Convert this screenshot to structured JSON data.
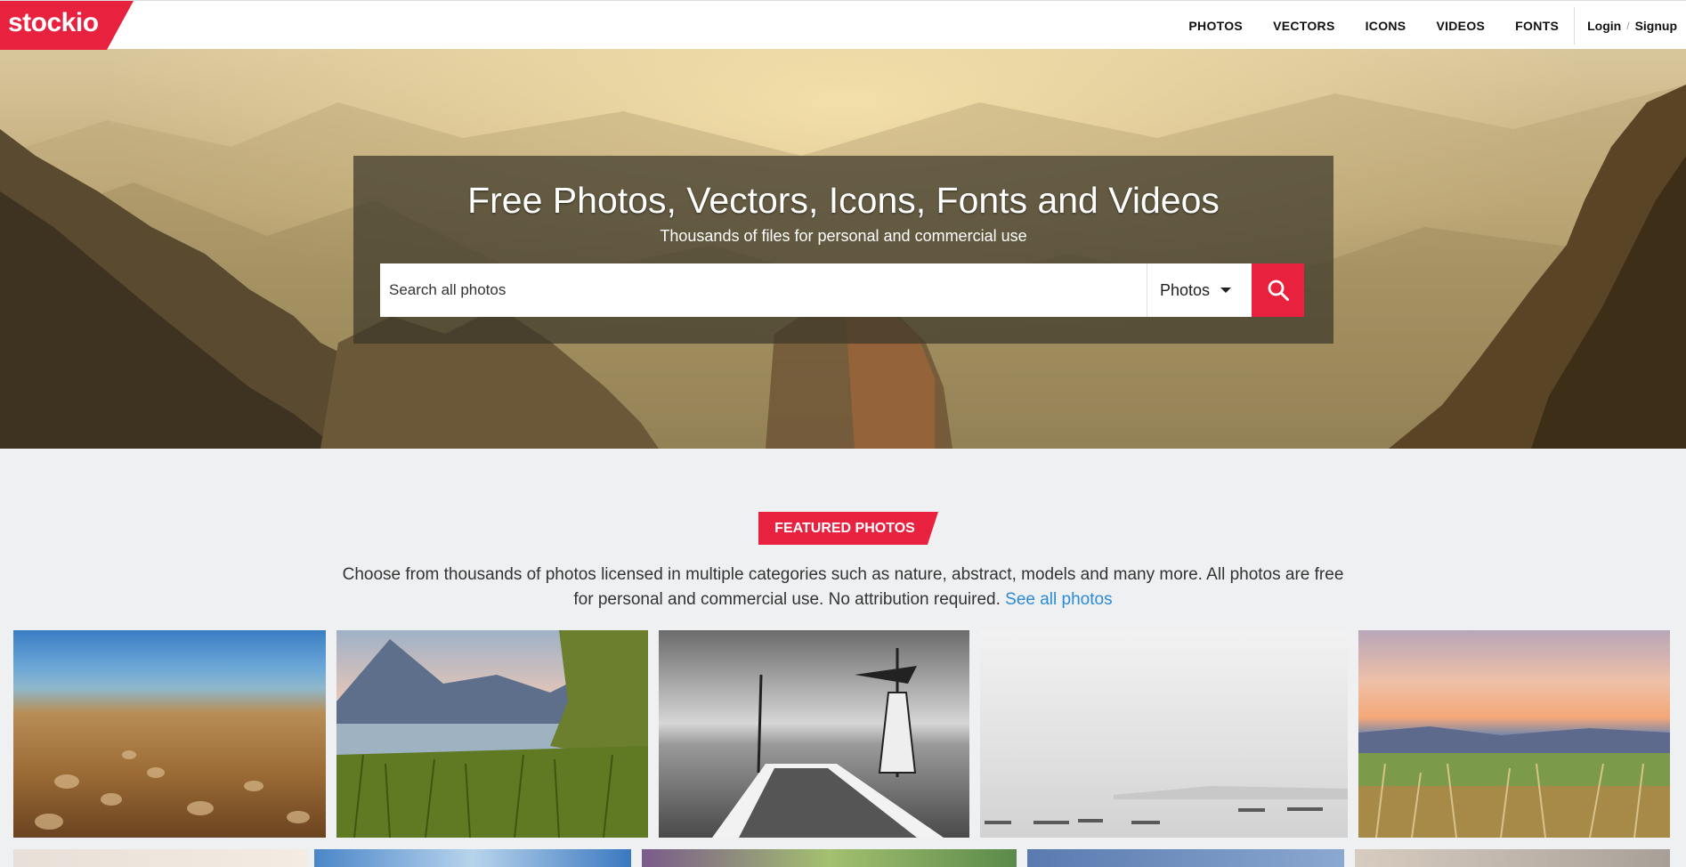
{
  "brand": {
    "logo_text": "stockio",
    "accent": "#e8213f"
  },
  "nav": {
    "items": [
      "PHOTOS",
      "VECTORS",
      "ICONS",
      "VIDEOS",
      "FONTS"
    ],
    "login": "Login",
    "separator": "/",
    "signup": "Signup"
  },
  "hero": {
    "title": "Free Photos, Vectors, Icons, Fonts and Videos",
    "subtitle": "Thousands of files for personal and commercial use",
    "search": {
      "placeholder": "Search all photos",
      "type_selected": "Photos"
    }
  },
  "featured": {
    "badge": "FEATURED PHOTOS",
    "description": "Choose from thousands of photos licensed in multiple categories such as nature, abstract, models and many more. All photos are free for personal and commercial use. No attribution required.",
    "link_text": "See all photos"
  },
  "icons": {
    "search": "search-icon",
    "dropdown": "chevron-down-icon"
  }
}
